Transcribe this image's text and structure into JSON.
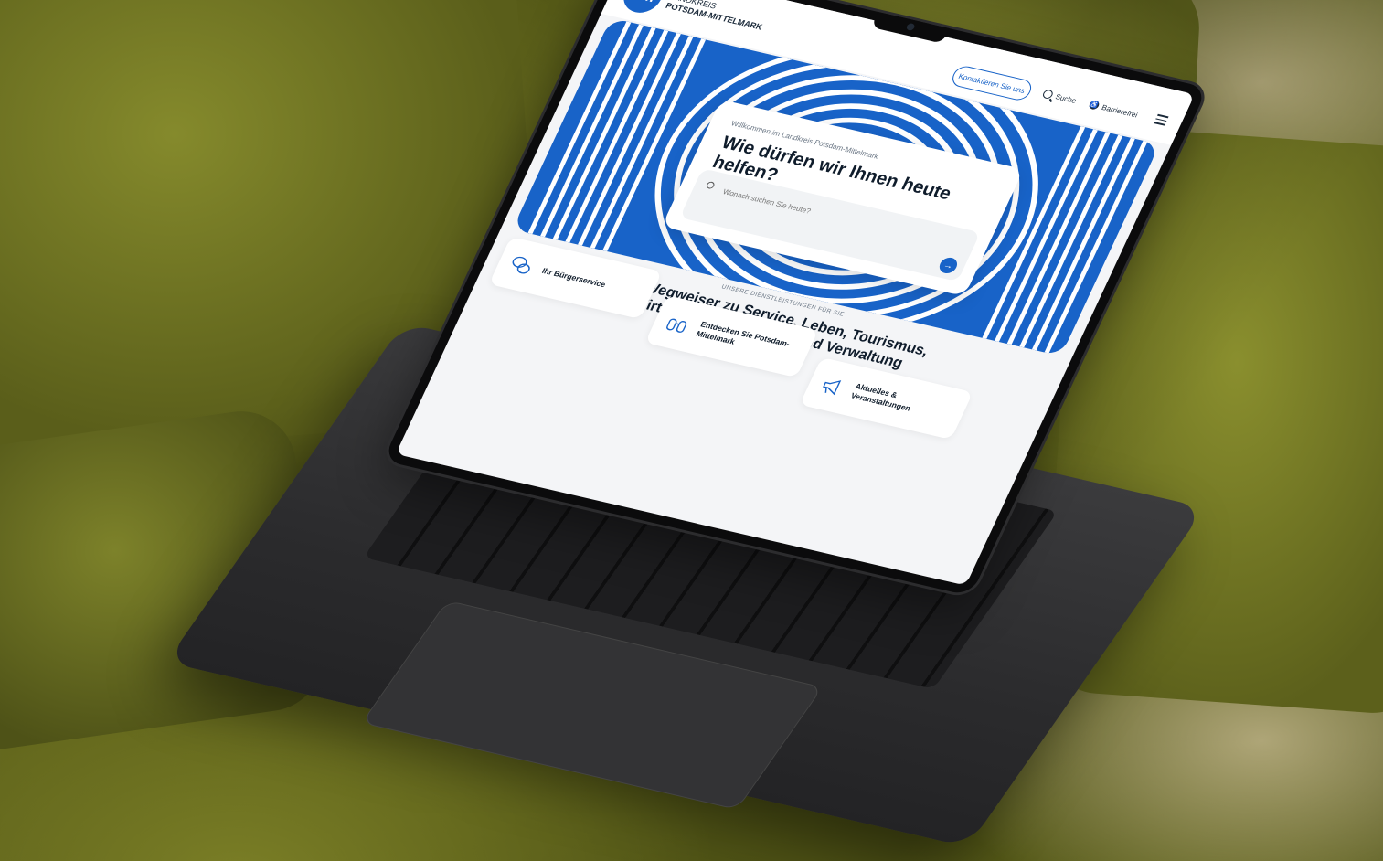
{
  "site": {
    "logo_mark": "PM",
    "logo_line1": "LANDKREIS",
    "logo_line2": "POTSDAM-MITTELMARK",
    "contact_label": "Kontaktieren Sie uns",
    "search_label": "Suche",
    "accessibility_label": "Barrierefrei",
    "brand_color": "#1863c8"
  },
  "hero": {
    "subtitle": "Willkommen im Landkreis Potsdam-Mittelmark",
    "title": "Wie dürfen wir Ihnen heute helfen?",
    "search_placeholder": "Wonach suchen Sie heute?"
  },
  "services": {
    "eyebrow": "UNSERE DIENSTLEISTUNGEN FÜR SIE",
    "title_line1": "Ihr Wegweiser zu Service, Leben, Tourismus,",
    "title_line2": "Wirtschaft, Neuigkeiten und Verwaltung",
    "tiles": [
      {
        "label": "Ihr Bürgerservice",
        "icon": "speech-bubbles-icon"
      },
      {
        "label": "Entdecken Sie Potsdam-Mittelmark",
        "icon": "binoculars-icon"
      },
      {
        "label": "Aktuelles & Veranstaltungen",
        "icon": "megaphone-icon"
      }
    ]
  }
}
